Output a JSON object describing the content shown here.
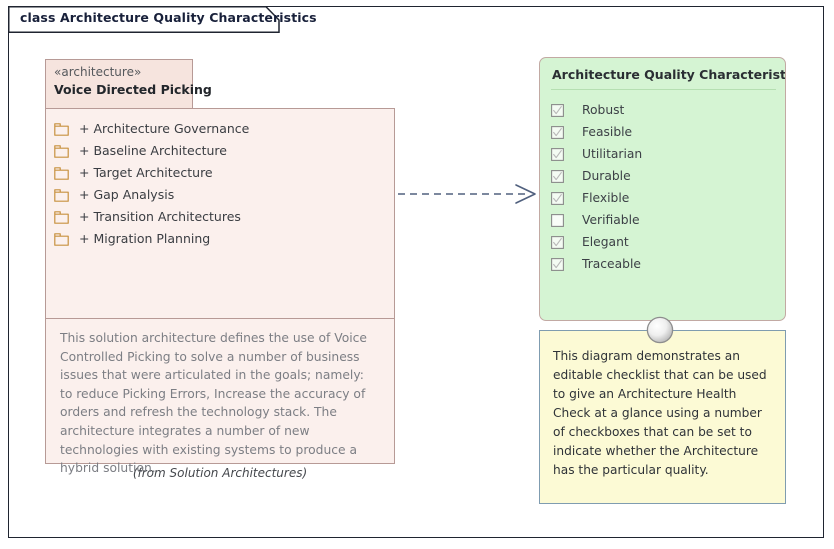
{
  "frame": {
    "label": "class Architecture Quality Characteristics"
  },
  "class_element": {
    "stereotype": "«architecture»",
    "name": "Voice Directed Picking",
    "caption": "(from Solution Architectures)",
    "attributes": [
      {
        "icon": "package-folder-icon",
        "label": "+ Architecture Governance"
      },
      {
        "icon": "package-folder-icon",
        "label": "+ Baseline Architecture"
      },
      {
        "icon": "package-folder-icon",
        "label": "+ Target Architecture"
      },
      {
        "icon": "package-folder-icon",
        "label": "+ Gap Analysis"
      },
      {
        "icon": "package-folder-icon",
        "label": "+ Transition Architectures"
      },
      {
        "icon": "package-folder-icon",
        "label": "+ Migration Planning"
      }
    ],
    "description": "This solution architecture defines the use of Voice Controlled Picking to solve a number of business issues that were articulated in the goals; namely: to reduce Picking Errors, Increase the accuracy of orders and refresh the technology stack. The architecture integrates a number of new technologies with existing systems to produce a hybrid solution."
  },
  "connector": {
    "type": "dependency",
    "style": "dashed-open-arrow",
    "color": "#50607e"
  },
  "checklist": {
    "title": "Architecture Quality Characteristics",
    "items": [
      {
        "label": "Robust",
        "checked": true
      },
      {
        "label": "Feasible",
        "checked": true
      },
      {
        "label": "Utilitarian",
        "checked": true
      },
      {
        "label": "Durable",
        "checked": true
      },
      {
        "label": "Flexible",
        "checked": true
      },
      {
        "label": "Verifiable",
        "checked": false
      },
      {
        "label": "Elegant",
        "checked": true
      },
      {
        "label": "Traceable",
        "checked": true
      }
    ]
  },
  "note": {
    "text": "This diagram demonstrates an editable checklist that can be used to give an Architecture Health Check at a glance using a number of checkboxes that can be set to indicate whether the Architecture has the particular quality."
  },
  "colors": {
    "class_header_fill": "#f6e4de",
    "class_body_fill": "#fbf0ed",
    "class_border": "#b79a96",
    "checklist_fill": "#d5f4d3",
    "checklist_border": "#c2a9a3",
    "note_fill": "#fcfad5",
    "note_border": "#7f9cb0",
    "frame_border": "#1f2430",
    "package_icon": "#c8913f"
  }
}
